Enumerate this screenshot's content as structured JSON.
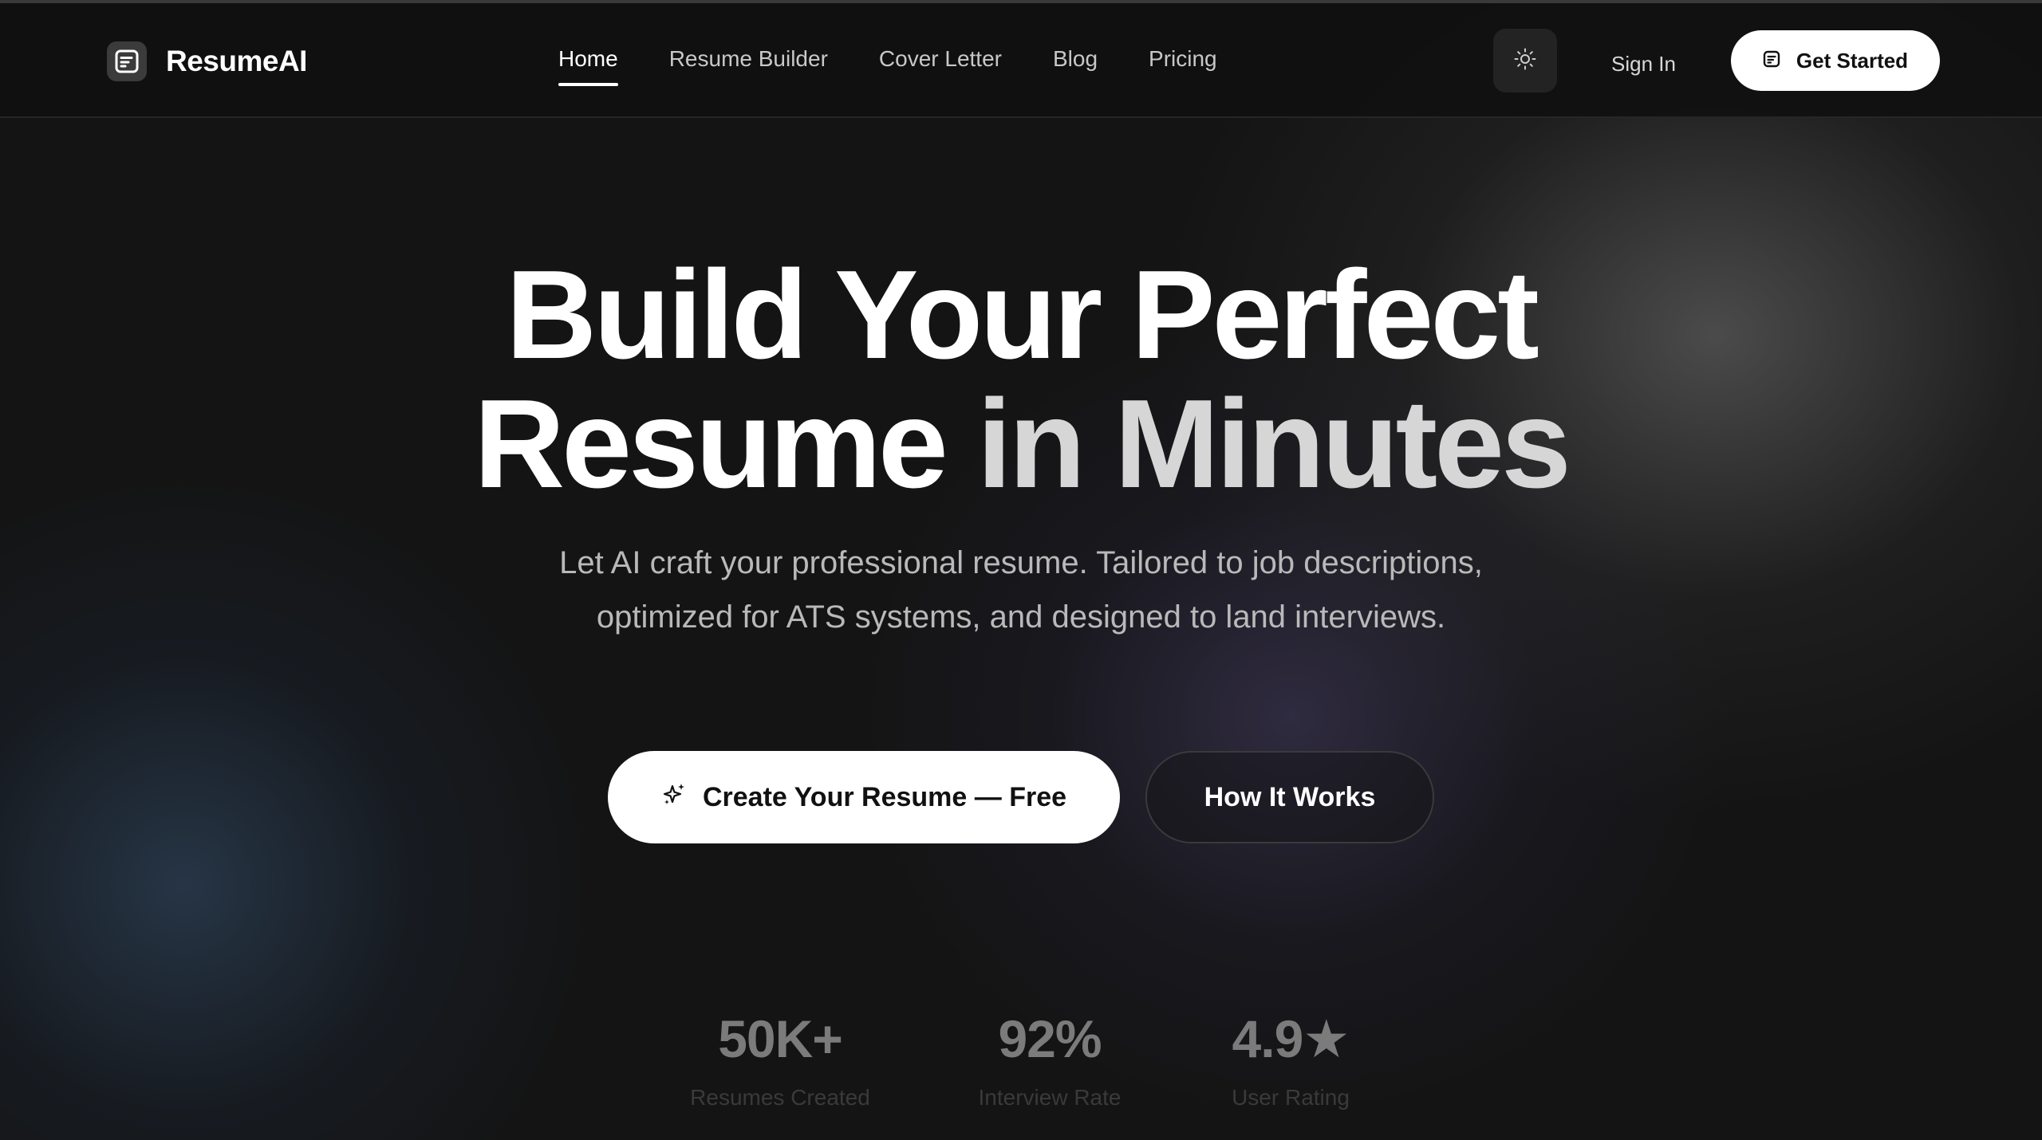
{
  "brand": {
    "name": "ResumeAI",
    "icon": "resume-doc-icon"
  },
  "nav": {
    "links": [
      {
        "label": "Home",
        "active": true
      },
      {
        "label": "Resume Builder",
        "active": false
      },
      {
        "label": "Cover Letter",
        "active": false
      },
      {
        "label": "Blog",
        "active": false
      },
      {
        "label": "Pricing",
        "active": false
      }
    ],
    "theme_icon": "sun-icon",
    "sign_in": "Sign In",
    "get_started": "Get Started"
  },
  "hero": {
    "title_line1": "Build Your Perfect",
    "title_line2_part1": "Resume ",
    "title_line2_accent": "in Minutes",
    "subtitle": "Let AI craft your professional resume. Tailored to job descriptions, optimized for ATS systems, and designed to land interviews.",
    "cta_primary": "Create Your Resume — Free",
    "cta_primary_icon": "sparkles-icon",
    "cta_secondary": "How It Works"
  },
  "stats": [
    {
      "value": "50K+",
      "label": "Resumes Created"
    },
    {
      "value": "92%",
      "label": "Interview Rate"
    },
    {
      "value": "4.9★",
      "label": "User Rating"
    }
  ],
  "colors": {
    "background": "#141414",
    "button_bg": "#ffffff",
    "button_text": "#111111",
    "accent_text": "#d6d6d6"
  }
}
